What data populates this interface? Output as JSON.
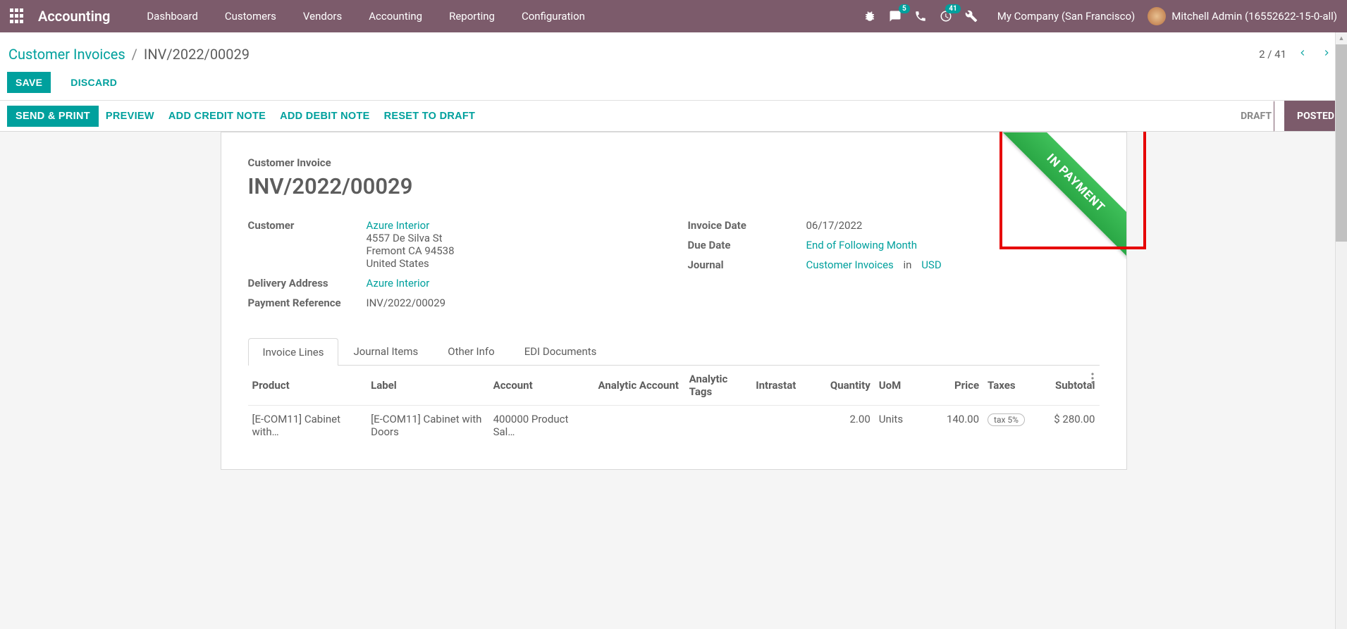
{
  "nav": {
    "brand": "Accounting",
    "menu": [
      "Dashboard",
      "Customers",
      "Vendors",
      "Accounting",
      "Reporting",
      "Configuration"
    ],
    "msg_badge": "5",
    "activity_badge": "41",
    "company": "My Company (San Francisco)",
    "user": "Mitchell Admin (16552622-15-0-all)"
  },
  "breadcrumb": {
    "parent": "Customer Invoices",
    "current": "INV/2022/00029"
  },
  "buttons": {
    "save": "SAVE",
    "discard": "DISCARD"
  },
  "pager": {
    "text": "2 / 41"
  },
  "actions": {
    "send_print": "SEND & PRINT",
    "preview": "PREVIEW",
    "credit_note": "ADD CREDIT NOTE",
    "debit_note": "ADD DEBIT NOTE",
    "reset_draft": "RESET TO DRAFT"
  },
  "status": {
    "draft": "DRAFT",
    "posted": "POSTED"
  },
  "ribbon": "IN PAYMENT",
  "doc": {
    "type": "Customer Invoice",
    "title": "INV/2022/00029"
  },
  "fields": {
    "customer_label": "Customer",
    "customer_name": "Azure Interior",
    "customer_addr1": "4557 De Silva St",
    "customer_addr2": "Fremont CA 94538",
    "customer_addr3": "United States",
    "delivery_label": "Delivery Address",
    "delivery_value": "Azure Interior",
    "payref_label": "Payment Reference",
    "payref_value": "INV/2022/00029",
    "invdate_label": "Invoice Date",
    "invdate_value": "06/17/2022",
    "duedate_label": "Due Date",
    "duedate_value": "End of Following Month",
    "journal_label": "Journal",
    "journal_value": "Customer Invoices",
    "journal_in": "in",
    "journal_currency": "USD"
  },
  "tabs": [
    "Invoice Lines",
    "Journal Items",
    "Other Info",
    "EDI Documents"
  ],
  "table": {
    "headers": {
      "product": "Product",
      "label": "Label",
      "account": "Account",
      "analytic_account": "Analytic Account",
      "analytic_tags": "Analytic Tags",
      "intrastat": "Intrastat",
      "quantity": "Quantity",
      "uom": "UoM",
      "price": "Price",
      "taxes": "Taxes",
      "subtotal": "Subtotal"
    },
    "row": {
      "product": "[E-COM11] Cabinet with…",
      "label": "[E-COM11] Cabinet with Doors",
      "account": "400000 Product Sal…",
      "quantity": "2.00",
      "uom": "Units",
      "price": "140.00",
      "tax": "tax 5%",
      "subtotal": "$ 280.00"
    }
  }
}
